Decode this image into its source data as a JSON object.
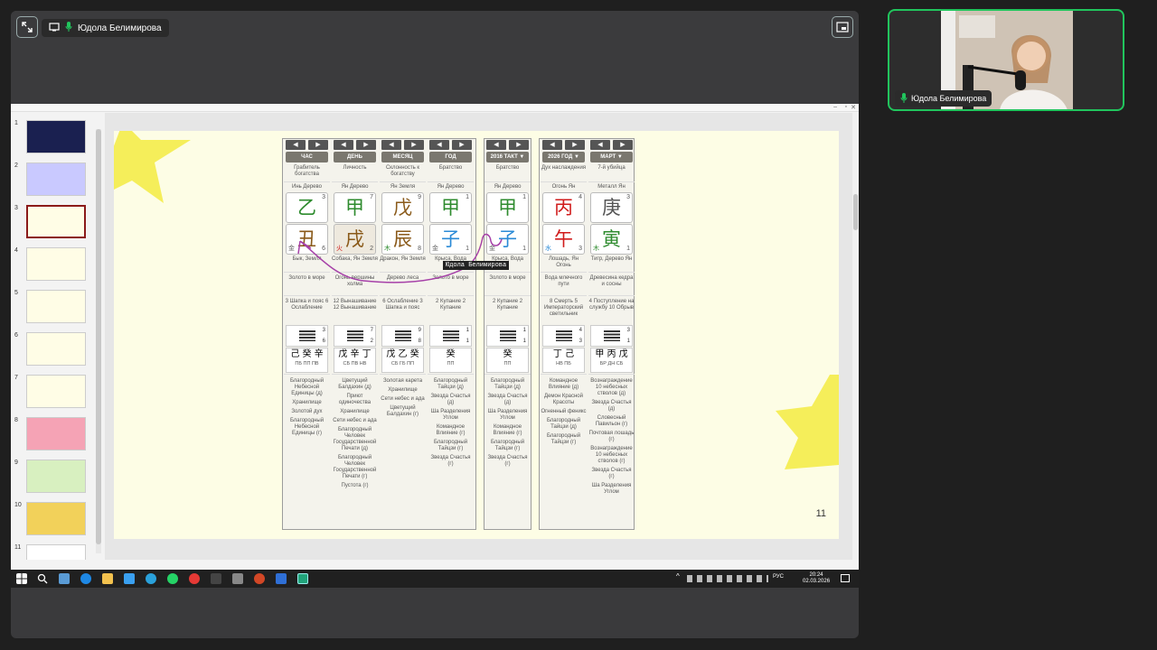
{
  "presenter": {
    "name": "Юдола Белимирова",
    "annotation_label": "Юдола Белимирова"
  },
  "colors": {
    "accent_green": "#21c55d",
    "wood": "#2e8b2e",
    "fire": "#d01b1b",
    "earth": "#8a5a1a",
    "metal": "#555555",
    "water": "#2a8ad6"
  },
  "slide": {
    "number": "11"
  },
  "thumbnails": [
    "1",
    "2",
    "3",
    "4",
    "5",
    "6",
    "7",
    "8",
    "9",
    "10",
    "11"
  ],
  "thumbnail_selected": "3",
  "taskbar": {
    "lang": "РУС",
    "time": "20:24",
    "date": "02.03.2026"
  },
  "columns": [
    {
      "header": "ЧАС",
      "r1": "Грабитель богатства",
      "r2": "Инь Дерево",
      "stem": "乙",
      "stem_num": "3",
      "stem_color": "wood",
      "branch": "丑",
      "branch_num": "6",
      "branch_side": "金",
      "branch_color": "earth",
      "r5": "Бык, Земля",
      "r6": "Золото в море",
      "r7": "3 Шапка и пояс 6 Ослабление",
      "hex_top": "3",
      "hex_bottom": "6",
      "hidden": "己 癸 辛",
      "hidden_labels": "ПБ ПП ПВ",
      "stars": [
        "Благородный Небесной Единицы (д)",
        "Хранилище",
        "Золотой дух",
        "Благородный Небесной Единицы (г)"
      ]
    },
    {
      "header": "ДЕНЬ",
      "r1": "Личность",
      "r2": "Ян Дерево",
      "stem": "甲",
      "stem_num": "7",
      "stem_color": "wood",
      "branch": "戌",
      "branch_num": "2",
      "branch_side": "火",
      "branch_color": "earth",
      "highlight": true,
      "r5": "Собака, Ян Земля",
      "r6": "Огонь вершины холма",
      "r7": "12 Вынашивание 12 Вынашивание",
      "hex_top": "7",
      "hex_bottom": "2",
      "hidden": "戊 辛 丁",
      "hidden_labels": "СБ ПВ НВ",
      "stars": [
        "Цветущий Балдахин (д)",
        "Приют одиночества",
        "Хранилище",
        "Сети небес и ада",
        "Благородный Человек Государственной Печати (д)",
        "Благородный Человек Государственной Печати (г)",
        "Пустота (г)"
      ]
    },
    {
      "header": "МЕСЯЦ",
      "r1": "Склонность к богатству",
      "r2": "Ян Земля",
      "stem": "戊",
      "stem_num": "9",
      "stem_color": "earth",
      "branch": "辰",
      "branch_num": "8",
      "branch_side": "木",
      "branch_color": "earth",
      "r5": "Дракон, Ян Земля",
      "r6": "Дерево леса",
      "r7": "6 Ослабление 3 Шапка и пояс",
      "hex_top": "9",
      "hex_bottom": "8",
      "hidden": "戊 乙 癸",
      "hidden_labels": "СБ ГБ ПП",
      "stars": [
        "Золотая карета",
        "Хранилище",
        "Сети небес и ада",
        "Цветущий Балдахин (г)"
      ]
    },
    {
      "header": "ГОД",
      "r1": "Братство",
      "r2": "Ян Дерево",
      "stem": "甲",
      "stem_num": "1",
      "stem_color": "wood",
      "branch": "子",
      "branch_num": "1",
      "branch_side": "金",
      "branch_color": "water",
      "r5": "Крыса, Вода",
      "r6": "Золото в море",
      "r7": "2 Купание 2 Купание",
      "hex_top": "1",
      "hex_bottom": "1",
      "hidden": "癸",
      "hidden_labels": "ПП",
      "stars": [
        "Благородный Тайцзи (д)",
        "Звезда Счастья (д)",
        "Ша Разделения Углом",
        "Командное Влияние (г)",
        "Благородный Тайцзи (г)",
        "Звезда Счастья (г)"
      ]
    },
    {
      "header": "2016 ТАКТ ▼",
      "r1": "Братство",
      "r2": "Ян Дерево",
      "stem": "甲",
      "stem_num": "1",
      "stem_color": "wood",
      "branch": "子",
      "branch_num": "1",
      "branch_side": "金",
      "branch_color": "water",
      "r5": "Крыса, Вода",
      "r6": "Золото в море",
      "r7": "2 Купание 2 Купание",
      "hex_top": "1",
      "hex_bottom": "1",
      "hidden": "癸",
      "hidden_labels": "ПП",
      "stars": [
        "Благородный Тайцзи (д)",
        "Звезда Счастья (д)",
        "Ша Разделения Углом",
        "Командное Влияние (г)",
        "Благородный Тайцзи (г)",
        "Звезда Счастья (г)"
      ]
    },
    {
      "header": "2026 ГОД ▼",
      "r1": "Дух наслаждения",
      "r2": "Огонь Ян",
      "stem": "丙",
      "stem_num": "4",
      "stem_color": "fire",
      "branch": "午",
      "branch_num": "3",
      "branch_side": "水",
      "branch_color": "fire",
      "r5": "Лошадь, Ян Огонь",
      "r6": "Вода млечного пути",
      "r7": "8 Смерть 5 Императорский светильник",
      "hex_top": "4",
      "hex_bottom": "3",
      "hidden": "丁 己",
      "hidden_labels": "НВ ПБ",
      "stars": [
        "Командное Влияние (д)",
        "Демон Красной Красоты",
        "Огненный феникс",
        "Благородный Тайцзи (д)",
        "Благородный Тайцзи (г)"
      ]
    },
    {
      "header": "МАРТ ▼",
      "r1": "7-й убийца",
      "r2": "Металл Ян",
      "stem": "庚",
      "stem_num": "3",
      "stem_color": "metal",
      "branch": "寅",
      "branch_num": "1",
      "branch_side": "木",
      "branch_color": "wood",
      "r5": "Тигр, Дерево Ян",
      "r6": "Древесина кедра и сосны",
      "r7": "4 Поступление на службу 10 Обрыв",
      "hex_top": "3",
      "hex_bottom": "1",
      "hidden": "甲 丙 戊",
      "hidden_labels": "БР ДН СБ",
      "stars": [
        "Вознаграждение 10 небесных стволов (д)",
        "Звезда Счастья (д)",
        "Словесный Павильон (г)",
        "Почтовая лошадь (г)",
        "Вознаграждение 10 небесных стволов (г)",
        "Звезда Счастья (г)",
        "Ша Разделения Углом"
      ]
    }
  ]
}
